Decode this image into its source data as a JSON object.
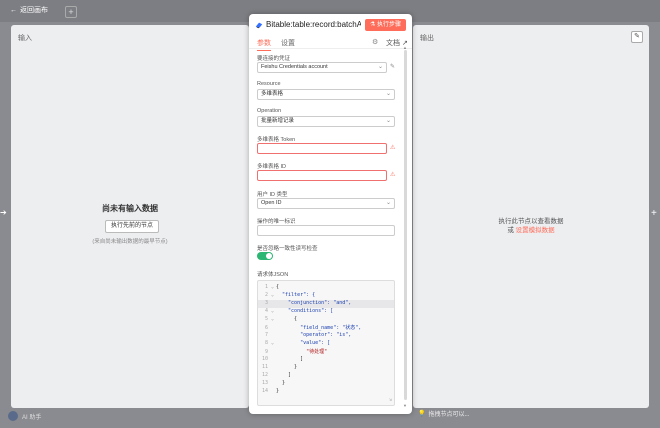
{
  "topbar": {
    "back_label": "返回画布",
    "back_icon": "arrow-left-icon",
    "add_icon": "plus-icon"
  },
  "input_panel": {
    "title": "输入",
    "empty_title": "尚未有输入数据",
    "exec_prev_label": "执行先前的节点",
    "hint": "(来自尚未输出数据的最早节点)"
  },
  "output_panel": {
    "title": "输出",
    "hint_line1": "执行此节点以查看数据",
    "hint_or": "或",
    "hint_link": "设置模拟数据",
    "edit_icon": "pencil-icon"
  },
  "modal": {
    "title": "Bitable:table:record:batchA...",
    "execute_label": "执行步骤",
    "tabs": [
      "参数",
      "设置"
    ],
    "docs_label": "文档",
    "fields": {
      "credential_label": "要连接的凭证",
      "credential_value": "Feishu Credentials account",
      "resource_label": "Resource",
      "resource_value": "多维表格",
      "operation_label": "Operation",
      "operation_value": "批量新增记录",
      "token_label": "多维表格 Token",
      "table_id_label": "多维表格 ID",
      "user_id_type_label": "用户 ID 类型",
      "user_id_type_value": "Open ID",
      "unique_id_label": "操作的唯一标识",
      "ignore_label": "是否忽略一致性读写检查",
      "body_label": "请求体JSON"
    },
    "code_lines": [
      "{",
      "  \"filter\": {",
      "    \"conjunction\": \"and\",",
      "    \"conditions\": [",
      "      {",
      "        \"field_name\": \"状态\",",
      "        \"operator\": \"is\",",
      "        \"value\": [",
      "          \"待处理\"",
      "        ]",
      "      }",
      "    ]",
      "  }",
      "}"
    ]
  },
  "bottom_left": {
    "label": "AI 助手",
    "avatar_icon": "avatar-icon"
  },
  "bottom_right": {
    "label": "拖拽节点可以...",
    "icon": "lightbulb-icon"
  },
  "colors": {
    "accent": "#ff6d5a",
    "toggle": "#2bb673",
    "panel": "#edeef0"
  }
}
